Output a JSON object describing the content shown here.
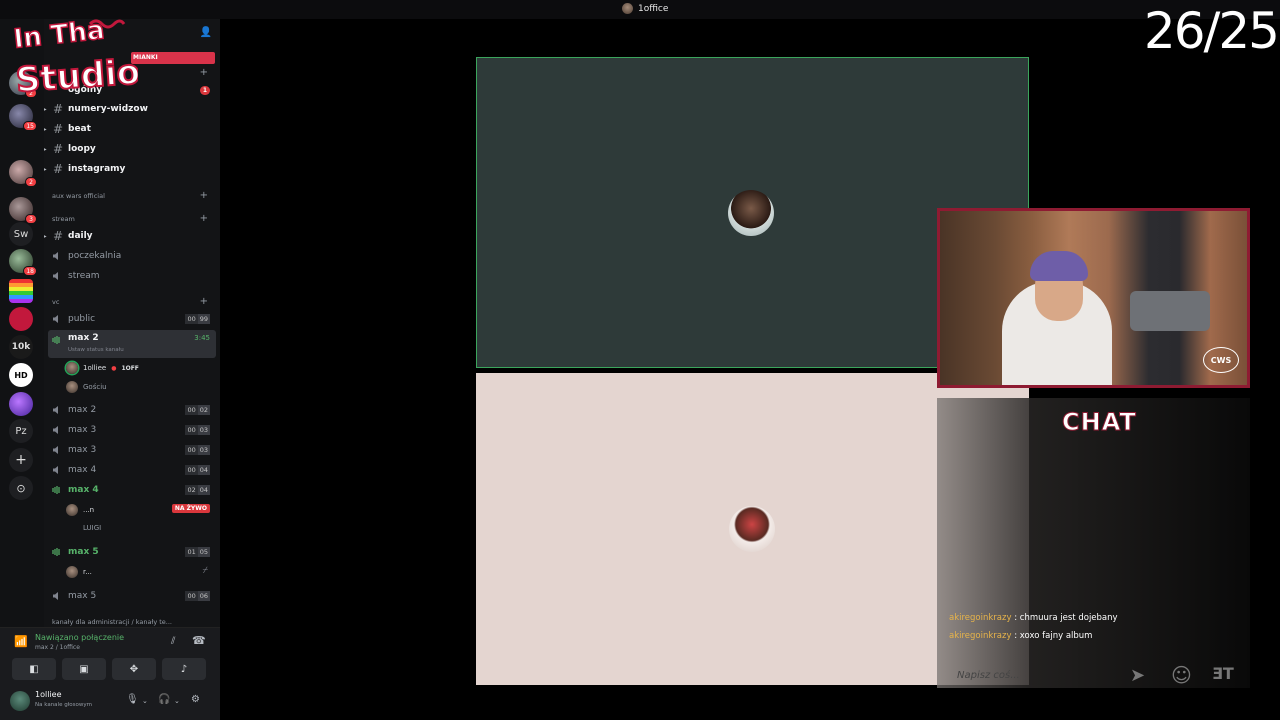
{
  "window": {
    "title": "1office"
  },
  "stream_overlay": {
    "counter": "26/25",
    "logo_text": [
      "In Tha",
      "Studio!"
    ],
    "chat_title": "CHAT",
    "webcam_logo": "CWS"
  },
  "rail": {
    "servers": [
      {
        "name": "server-1",
        "badge": ""
      },
      {
        "name": "server-2",
        "badge": "2"
      },
      {
        "name": "server-3",
        "badge": "15"
      },
      {
        "name": "server-4",
        "badge": "2"
      },
      {
        "name": "server-5",
        "badge": "3"
      },
      {
        "name": "Sw",
        "badge": ""
      },
      {
        "name": "server-7",
        "badge": "18"
      },
      {
        "name": "server-8",
        "badge": ""
      },
      {
        "name": "server-9",
        "badge": ""
      },
      {
        "name": "10k",
        "badge": ""
      },
      {
        "name": "HD",
        "badge": ""
      },
      {
        "name": "server-12",
        "badge": ""
      },
      {
        "name": "Pz",
        "badge": ""
      }
    ]
  },
  "sidebar": {
    "category_badge": "MIANKI",
    "text_channels": [
      {
        "name": "ogólny",
        "badge": "1"
      },
      {
        "name": "numery-widzow"
      },
      {
        "name": "beat"
      },
      {
        "name": "loopy"
      },
      {
        "name": "instagramy"
      }
    ],
    "cat_aux": "aux wars official",
    "cat_stream": "stream",
    "stream_channels": [
      "daily",
      "poczekalnia",
      "stream"
    ],
    "cat_vc": "vc",
    "voice_public": {
      "name": "public",
      "a": "00",
      "b": "99"
    },
    "voice_active": {
      "name": "max 2",
      "time": "3:45",
      "status": "Ustaw status kanału"
    },
    "active_users": [
      {
        "name": "1olliee",
        "tag": "1OFF"
      },
      {
        "name": "Gościu"
      }
    ],
    "voice_rooms": [
      {
        "name": "max 2",
        "a": "00",
        "b": "02"
      },
      {
        "name": "max 3",
        "a": "00",
        "b": "03"
      },
      {
        "name": "max 3",
        "a": "00",
        "b": "03"
      },
      {
        "name": "max 4",
        "a": "00",
        "b": "04"
      },
      {
        "name": "max 4",
        "a": "02",
        "b": "04"
      }
    ],
    "max4_users": [
      {
        "name": "...n",
        "live": "NA ŻYWO"
      },
      {
        "name": "LUIGI"
      }
    ],
    "max5": {
      "name": "max 5",
      "a": "01",
      "b": "05"
    },
    "max5_users": [
      {
        "name": "r..."
      }
    ],
    "max5b": {
      "name": "max 5",
      "a": "00",
      "b": "06"
    },
    "bottom_cat": "kanały dla administracji / kanały te..."
  },
  "voice_panel": {
    "status": "Nawiązano połączenie",
    "channel": "max 2 / 1office",
    "username": "1olliee",
    "user_status": "Na kanale głosowym"
  },
  "chat": {
    "messages": [
      {
        "user": "akiregoinkrazy",
        "text": ": chmuura jest dojebany"
      },
      {
        "user": "akiregoinkrazy",
        "text": ": xoxo fajny album"
      }
    ],
    "input_placeholder": "Napisz coś..."
  },
  "colors": {
    "accent_red": "#8e1b32",
    "speaking_green": "#3ba55c",
    "live_red": "#da373c"
  }
}
